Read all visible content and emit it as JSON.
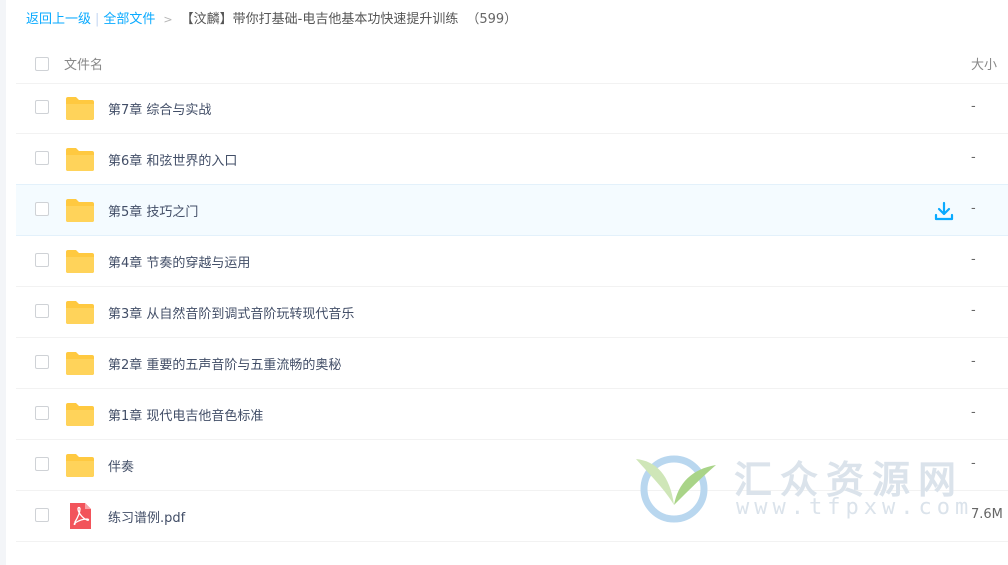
{
  "breadcrumb": {
    "back": "返回上一级",
    "separator": "|",
    "all_files": "全部文件",
    "arrow": ">",
    "current": "【汶麟】带你打基础-电吉他基本功快速提升训练",
    "count": "（599）"
  },
  "header": {
    "name_col": "文件名",
    "size_col": "大小"
  },
  "files": [
    {
      "name": "第7章 综合与实战",
      "size": "-",
      "type": "folder",
      "icon": "folder-icon"
    },
    {
      "name": "第6章 和弦世界的入口",
      "size": "-",
      "type": "folder",
      "icon": "folder-icon"
    },
    {
      "name": "第5章 技巧之门",
      "size": "-",
      "type": "folder",
      "icon": "folder-icon",
      "hovered": true
    },
    {
      "name": "第4章 节奏的穿越与运用",
      "size": "-",
      "type": "folder",
      "icon": "folder-icon"
    },
    {
      "name": "第3章 从自然音阶到调式音阶玩转现代音乐",
      "size": "-",
      "type": "folder",
      "icon": "folder-icon"
    },
    {
      "name": "第2章 重要的五声音阶与五重流畅的奥秘",
      "size": "-",
      "type": "folder",
      "icon": "folder-icon"
    },
    {
      "name": "第1章 现代电吉他音色标准",
      "size": "-",
      "type": "folder",
      "icon": "folder-icon"
    },
    {
      "name": "伴奏",
      "size": "-",
      "type": "folder",
      "icon": "folder-icon"
    },
    {
      "name": "练习谱例.pdf",
      "size": "7.6M",
      "type": "pdf",
      "icon": "pdf-icon"
    }
  ],
  "watermark": {
    "title": "汇众资源网",
    "url": "www.tfpxw.com"
  },
  "colors": {
    "link": "#09aaff",
    "folder": "#ffd35a",
    "pdf": "#f2545b",
    "hover_row": "#f4fbff",
    "download_icon": "#09aaff"
  }
}
